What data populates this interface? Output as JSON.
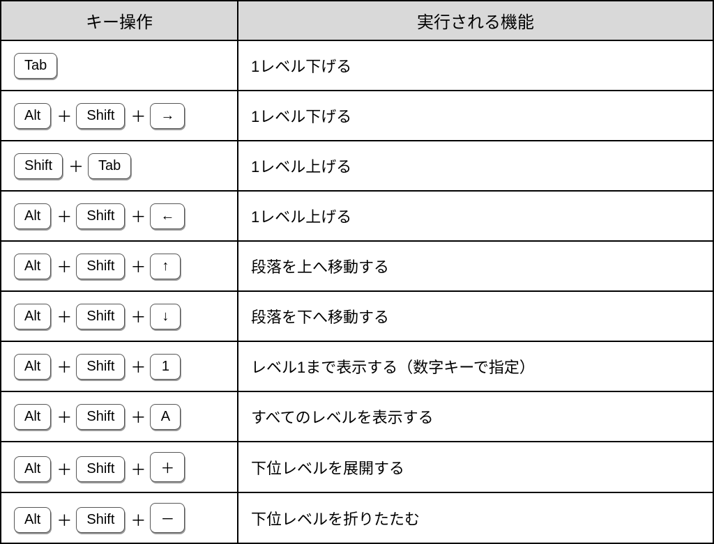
{
  "headers": {
    "col1": "キー操作",
    "col2": "実行される機能"
  },
  "joiner": "＋",
  "rows": [
    {
      "keys": [
        "Tab"
      ],
      "desc": "1レベル下げる"
    },
    {
      "keys": [
        "Alt",
        "Shift",
        "→"
      ],
      "desc": "1レベル下げる"
    },
    {
      "keys": [
        "Shift",
        "Tab"
      ],
      "desc": "1レベル上げる"
    },
    {
      "keys": [
        "Alt",
        "Shift",
        "←"
      ],
      "desc": "1レベル上げる"
    },
    {
      "keys": [
        "Alt",
        "Shift",
        "↑"
      ],
      "desc": "段落を上へ移動する"
    },
    {
      "keys": [
        "Alt",
        "Shift",
        "↓"
      ],
      "desc": "段落を下へ移動する"
    },
    {
      "keys": [
        "Alt",
        "Shift",
        "1"
      ],
      "desc": "レベル1まで表示する（数字キーで指定）"
    },
    {
      "keys": [
        "Alt",
        "Shift",
        "A"
      ],
      "desc": "すべてのレベルを表示する"
    },
    {
      "keys": [
        "Alt",
        "Shift",
        "＋"
      ],
      "desc": "下位レベルを展開する"
    },
    {
      "keys": [
        "Alt",
        "Shift",
        "－"
      ],
      "desc": "下位レベルを折りたたむ"
    }
  ]
}
